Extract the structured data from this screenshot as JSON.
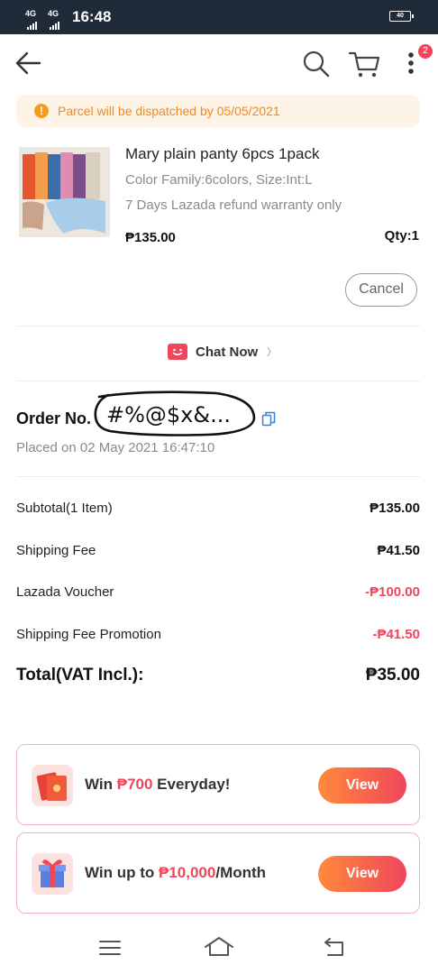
{
  "status_bar": {
    "network1": "4G",
    "network2": "4G",
    "time": "16:48",
    "battery": "40"
  },
  "header": {
    "cart_badge": "2"
  },
  "banner": {
    "text": "Parcel  will be dispatched by 05/05/2021",
    "icon": "info-icon"
  },
  "product": {
    "title": "Mary plain panty 6pcs 1pack",
    "variation": "Color Family:6colors, Size:Int:L",
    "warranty": "7 Days Lazada refund warranty only",
    "price": "₱135.00",
    "qty": "Qty:1",
    "cancel_label": "Cancel"
  },
  "chat": {
    "label": "Chat Now"
  },
  "order": {
    "label": "Order No.",
    "number": "#%@$x&...",
    "placed": "Placed on 02 May 2021  16:47:10"
  },
  "summary": {
    "rows": [
      {
        "label": "Subtotal(1 Item)",
        "value": "₱135.00"
      },
      {
        "label": "Shipping Fee",
        "value": "₱41.50"
      },
      {
        "label": "Lazada Voucher",
        "value": "-₱100.00"
      },
      {
        "label": "Shipping Fee Promotion",
        "value": "-₱41.50"
      }
    ],
    "total_label": "Total(VAT Incl.):",
    "total_value": "₱35.00"
  },
  "promos": [
    {
      "pre": "Win ",
      "highlight": "₱700",
      "post": " Everyday!",
      "button": "View"
    },
    {
      "pre": "Win up to ",
      "highlight": "₱10,000",
      "post": "/Month",
      "button": "View"
    }
  ],
  "colors": {
    "accent": "#f0465c",
    "banner_text": "#f08a24",
    "banner_bg": "#fdf3e7"
  }
}
